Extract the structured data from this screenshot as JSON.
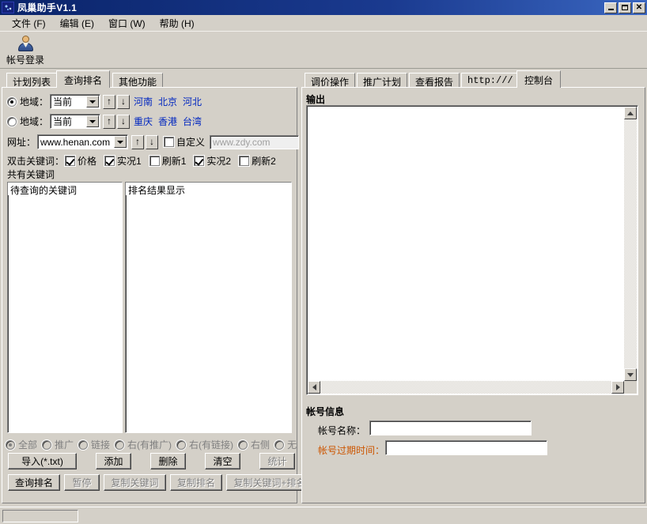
{
  "window": {
    "title": "凤巢助手V1.1",
    "minimize_label": "_",
    "maximize_label": "□",
    "close_label": "✕"
  },
  "menubar": {
    "items": [
      {
        "label": "文件 (F)"
      },
      {
        "label": "编辑 (E)"
      },
      {
        "label": "窗口 (W)"
      },
      {
        "label": "帮助 (H)"
      }
    ]
  },
  "toolbar": {
    "login_label": "帐号登录"
  },
  "left": {
    "tabs": [
      {
        "label": "计划列表",
        "selected": false
      },
      {
        "label": "查询排名",
        "selected": true
      },
      {
        "label": "其他功能",
        "selected": false
      }
    ],
    "region_row1": {
      "label": "地域：",
      "combo_value": "当前",
      "up_label": "↑",
      "down_label": "↓",
      "links": [
        "河南",
        "北京",
        "河北"
      ],
      "selected": true
    },
    "region_row2": {
      "label": "地域：",
      "combo_value": "当前",
      "up_label": "↑",
      "down_label": "↓",
      "links": [
        "重庆",
        "香港",
        "台湾"
      ],
      "selected": false
    },
    "url_row": {
      "label": "网址：",
      "combo_value": "www.henan.com",
      "up_label": "↑",
      "down_label": "↓",
      "custom_label": "自定义",
      "custom_checked": false,
      "custom_placeholder": "www.zdy.com"
    },
    "keyword_row": {
      "label": "双击关键词：",
      "options": [
        {
          "label": "价格",
          "checked": true
        },
        {
          "label": "实况1",
          "checked": true
        },
        {
          "label": "刷新1",
          "checked": false
        },
        {
          "label": "实况2",
          "checked": true
        },
        {
          "label": "刷新2",
          "checked": false
        }
      ]
    },
    "common_keyword_label": "共有关键词",
    "list_left_header": "待查询的关键词",
    "list_right_header": "排名结果显示",
    "filter_radios": [
      {
        "label": "全部",
        "checked": true
      },
      {
        "label": "推广",
        "checked": false
      },
      {
        "label": "链接",
        "checked": false
      },
      {
        "label": "右(有推广)",
        "checked": false
      },
      {
        "label": "右(有链接)",
        "checked": false
      },
      {
        "label": "右侧",
        "checked": false
      },
      {
        "label": "无",
        "checked": false
      }
    ],
    "buttons_row1": [
      {
        "label": "导入(*.txt)",
        "disabled": false
      },
      {
        "label": "添加",
        "disabled": false
      },
      {
        "label": "删除",
        "disabled": false
      },
      {
        "label": "清空",
        "disabled": false
      },
      {
        "label": "统计",
        "disabled": true
      }
    ],
    "buttons_row2": [
      {
        "label": "查询排名",
        "disabled": false
      },
      {
        "label": "暂停",
        "disabled": true
      },
      {
        "label": "复制关键词",
        "disabled": true
      },
      {
        "label": "复制排名",
        "disabled": true
      },
      {
        "label": "复制关键词+排名",
        "disabled": true
      }
    ]
  },
  "right": {
    "tabs": [
      {
        "label": "调价操作",
        "selected": false
      },
      {
        "label": "推广计划",
        "selected": false
      },
      {
        "label": "查看报告",
        "selected": false
      },
      {
        "label": "http:///",
        "selected": false
      },
      {
        "label": "控制台",
        "selected": true
      }
    ],
    "output_label": "输出",
    "output_value": "",
    "account_group_label": "帐号信息",
    "account_name_label": "帐号名称：",
    "account_name_value": "",
    "account_expire_label": "帐号过期时间：",
    "account_expire_value": ""
  },
  "statusbar": {
    "pane_text": ""
  },
  "colors": {
    "titlebar_start": "#0a246a",
    "face": "#d4d0c8",
    "link": "#0026c0",
    "warning": "#cc5500"
  }
}
